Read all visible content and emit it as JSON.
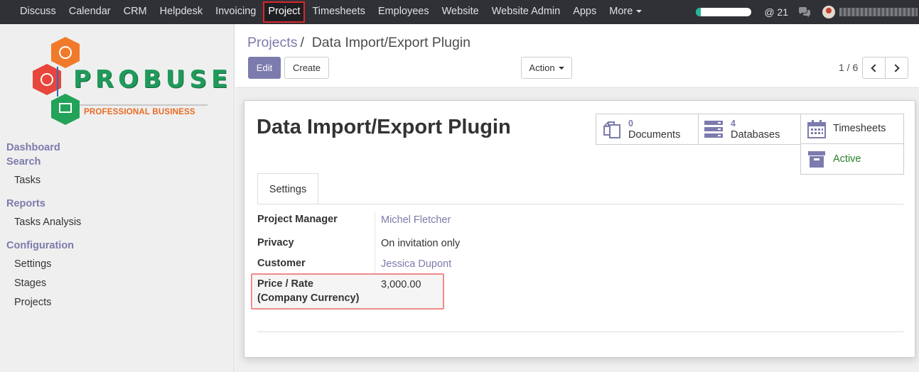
{
  "topnav": {
    "items": [
      "Discuss",
      "Calendar",
      "CRM",
      "Helpdesk",
      "Invoicing",
      "Project",
      "Timesheets",
      "Employees",
      "Website",
      "Website Admin",
      "Apps",
      "More"
    ],
    "active": "Project",
    "mentions": "@ 21",
    "progress_fill": 0.08
  },
  "logo": {
    "name": "PROBUSE",
    "tagline": "PROFESSIONAL BUSINESS"
  },
  "sidebar": {
    "sections": [
      {
        "title": "Dashboard"
      },
      {
        "title": "Search",
        "items": [
          "Tasks"
        ]
      },
      {
        "title": "Reports",
        "items": [
          "Tasks Analysis"
        ]
      },
      {
        "title": "Configuration",
        "items": [
          "Settings",
          "Stages",
          "Projects"
        ]
      }
    ]
  },
  "breadcrumb": {
    "parent": "Projects",
    "separator": "/",
    "current": "Data Import/Export Plugin"
  },
  "toolbar": {
    "edit_label": "Edit",
    "create_label": "Create",
    "action_label": "Action",
    "pager": "1 / 6"
  },
  "record": {
    "title": "Data Import/Export Plugin",
    "stat_buttons": {
      "documents": {
        "count": "0",
        "label": "Documents"
      },
      "databases": {
        "count": "4",
        "label": "Databases"
      },
      "timesheets": {
        "label": "Timesheets"
      },
      "active": {
        "label": "Active"
      }
    },
    "tab": "Settings",
    "fields": {
      "project_manager": {
        "label": "Project Manager",
        "value": "Michel Fletcher"
      },
      "privacy": {
        "label": "Privacy",
        "value": "On invitation only"
      },
      "customer": {
        "label": "Customer",
        "value": "Jessica Dupont"
      },
      "price_rate": {
        "label_line1": "Price / Rate",
        "label_line2": "(Company Currency)",
        "value": "3,000.00"
      }
    }
  },
  "colors": {
    "navbar": "#2f3136",
    "accent": "#7c7bad",
    "active_green": "#2a7f2a",
    "highlight": "#f08a8a"
  }
}
